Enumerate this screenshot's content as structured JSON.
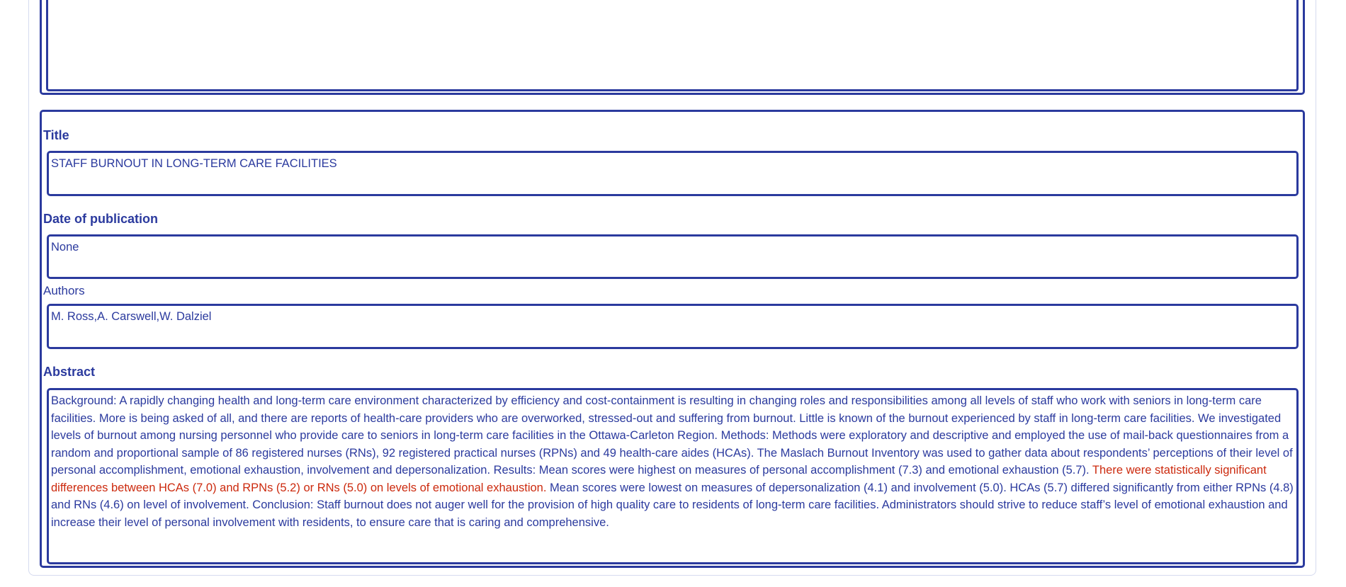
{
  "fields": {
    "title": {
      "label": "Title",
      "value": "STAFF BURNOUT IN LONG-TERM CARE FACILITIES"
    },
    "date": {
      "label": "Date of publication",
      "value": "None"
    },
    "authors": {
      "label": "Authors",
      "value": "M. Ross,A. Carswell,W. Dalziel"
    },
    "abstract": {
      "label": "Abstract",
      "before": "Background: A rapidly changing health and long-term care environment characterized by efficiency and cost-containment is resulting in changing roles and responsibilities among all levels of staff who work with seniors in long-term care facilities. More is being asked of all, and there are reports of health-care providers who are overworked, stressed-out and suffering from burnout. Little is known of the burnout experienced by staff in long-term care facilities. We investigated levels of burnout among nursing personnel who provide care to seniors in long-term care facilities in the Ottawa-Carleton Region. Methods: Methods were exploratory and descriptive and employed the use of mail-back questionnaires from a random and proportional sample of 86 registered nurses (RNs), 92 registered practical nurses (RPNs) and 49 health-care aides (HCAs). The Maslach Burnout Inventory was used to gather data about respondents’ perceptions of their level of personal accomplishment, emotional exhaustion, involvement and depersonalization. Results: Mean scores were highest on measures of personal accomplishment (7.3) and emotional exhaustion (5.7). ",
      "highlight": "There were statistically significant differences between HCAs (7.0) and RPNs (5.2) or RNs (5.0) on levels of emotional exhaustion.",
      "after": " Mean scores were lowest on measures of depersonalization (4.1) and involvement (5.0). HCAs (5.7) differed significantly from either RPNs (4.8) and RNs (4.6) on level of involvement. Conclusion: Staff burnout does not auger well for the provision of high quality care to residents of long-term care facilities. Administrators should strive to reduce staff’s level of emotional exhaustion and increase their level of personal involvement with residents, to ensure care that is caring and comprehensive."
    }
  },
  "colors": {
    "primary": "#2b3a9e",
    "highlight": "#cc2a0e",
    "card_border": "#d6dbef"
  }
}
